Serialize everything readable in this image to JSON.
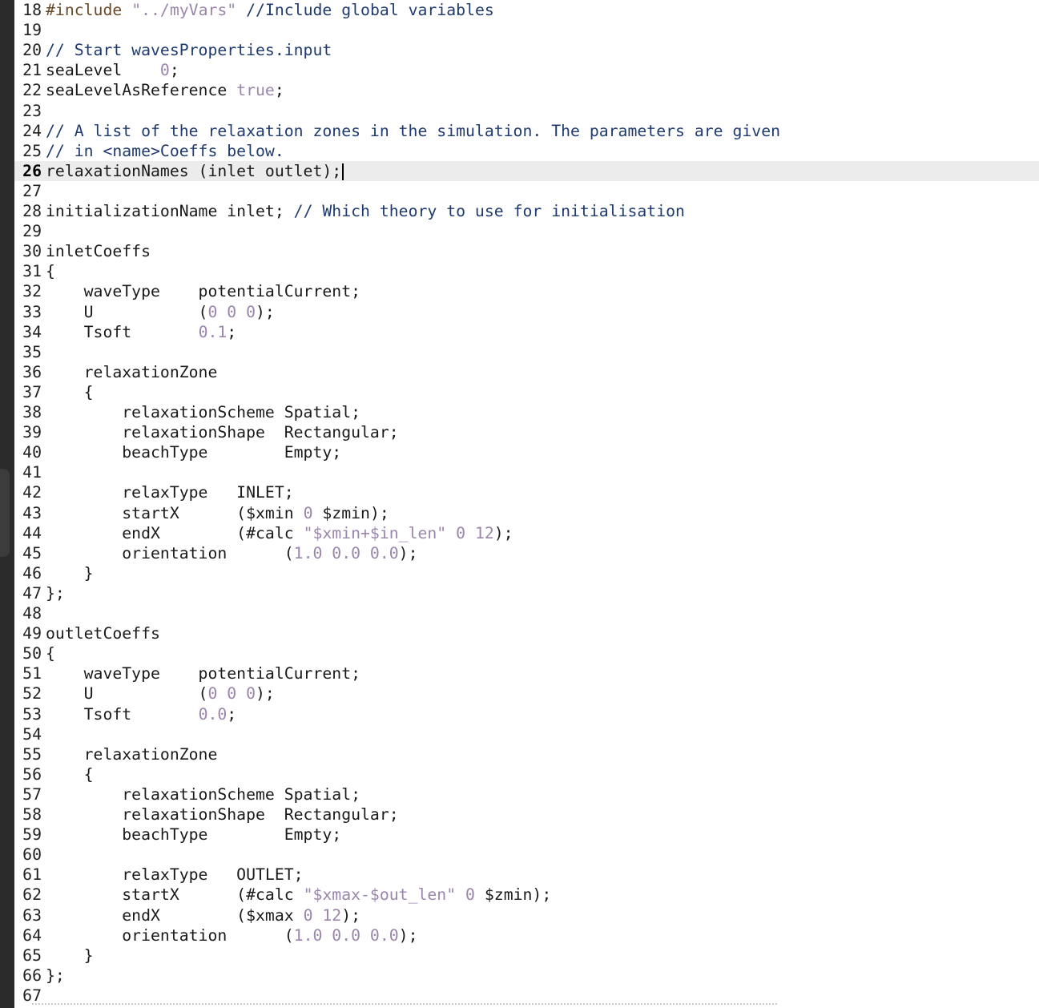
{
  "editor": {
    "current_line": "26",
    "lines": [
      {
        "n": "18",
        "tokens": [
          {
            "t": "preproc",
            "v": "#include"
          },
          {
            "t": "text",
            "v": " "
          },
          {
            "t": "string",
            "v": "\"../myVars\""
          },
          {
            "t": "text",
            "v": " "
          },
          {
            "t": "comment",
            "v": "//Include global variables"
          }
        ]
      },
      {
        "n": "19",
        "tokens": []
      },
      {
        "n": "20",
        "tokens": [
          {
            "t": "comment",
            "v": "// Start wavesProperties.input"
          }
        ]
      },
      {
        "n": "21",
        "tokens": [
          {
            "t": "text",
            "v": "seaLevel    "
          },
          {
            "t": "number",
            "v": "0"
          },
          {
            "t": "text",
            "v": ";"
          }
        ]
      },
      {
        "n": "22",
        "tokens": [
          {
            "t": "text",
            "v": "seaLevelAsReference "
          },
          {
            "t": "keyword",
            "v": "true"
          },
          {
            "t": "text",
            "v": ";"
          }
        ]
      },
      {
        "n": "23",
        "tokens": []
      },
      {
        "n": "24",
        "tokens": [
          {
            "t": "comment",
            "v": "// A list of the relaxation zones in the simulation. The parameters are given"
          }
        ]
      },
      {
        "n": "25",
        "tokens": [
          {
            "t": "comment",
            "v": "// in <name>Coeffs below."
          }
        ]
      },
      {
        "n": "26",
        "tokens": [
          {
            "t": "text",
            "v": "relaxationNames (inlet outlet);"
          }
        ]
      },
      {
        "n": "27",
        "tokens": []
      },
      {
        "n": "28",
        "tokens": [
          {
            "t": "text",
            "v": "initializationName inlet; "
          },
          {
            "t": "comment",
            "v": "// Which theory to use for initialisation"
          }
        ]
      },
      {
        "n": "29",
        "tokens": []
      },
      {
        "n": "30",
        "tokens": [
          {
            "t": "text",
            "v": "inletCoeffs"
          }
        ]
      },
      {
        "n": "31",
        "tokens": [
          {
            "t": "text",
            "v": "{"
          }
        ]
      },
      {
        "n": "32",
        "tokens": [
          {
            "t": "text",
            "v": "    waveType    potentialCurrent;"
          }
        ]
      },
      {
        "n": "33",
        "tokens": [
          {
            "t": "text",
            "v": "    U           ("
          },
          {
            "t": "number",
            "v": "0 0 0"
          },
          {
            "t": "text",
            "v": ");"
          }
        ]
      },
      {
        "n": "34",
        "tokens": [
          {
            "t": "text",
            "v": "    Tsoft       "
          },
          {
            "t": "number",
            "v": "0.1"
          },
          {
            "t": "text",
            "v": ";"
          }
        ]
      },
      {
        "n": "35",
        "tokens": []
      },
      {
        "n": "36",
        "tokens": [
          {
            "t": "text",
            "v": "    relaxationZone"
          }
        ]
      },
      {
        "n": "37",
        "tokens": [
          {
            "t": "text",
            "v": "    {"
          }
        ]
      },
      {
        "n": "38",
        "tokens": [
          {
            "t": "text",
            "v": "        relaxationScheme Spatial;"
          }
        ]
      },
      {
        "n": "39",
        "tokens": [
          {
            "t": "text",
            "v": "        relaxationShape  Rectangular;"
          }
        ]
      },
      {
        "n": "40",
        "tokens": [
          {
            "t": "text",
            "v": "        beachType        Empty;"
          }
        ]
      },
      {
        "n": "41",
        "tokens": []
      },
      {
        "n": "42",
        "tokens": [
          {
            "t": "text",
            "v": "        relaxType   INLET;"
          }
        ]
      },
      {
        "n": "43",
        "tokens": [
          {
            "t": "text",
            "v": "        startX      ($xmin "
          },
          {
            "t": "number",
            "v": "0"
          },
          {
            "t": "text",
            "v": " $zmin);"
          }
        ]
      },
      {
        "n": "44",
        "tokens": [
          {
            "t": "text",
            "v": "        endX        (#calc "
          },
          {
            "t": "string",
            "v": "\"$xmin+$in_len\""
          },
          {
            "t": "text",
            "v": " "
          },
          {
            "t": "number",
            "v": "0 12"
          },
          {
            "t": "text",
            "v": ");"
          }
        ]
      },
      {
        "n": "45",
        "tokens": [
          {
            "t": "text",
            "v": "        orientation      ("
          },
          {
            "t": "number",
            "v": "1.0 0.0 0.0"
          },
          {
            "t": "text",
            "v": ");"
          }
        ]
      },
      {
        "n": "46",
        "tokens": [
          {
            "t": "text",
            "v": "    }"
          }
        ]
      },
      {
        "n": "47",
        "tokens": [
          {
            "t": "text",
            "v": "};"
          }
        ]
      },
      {
        "n": "48",
        "tokens": []
      },
      {
        "n": "49",
        "tokens": [
          {
            "t": "text",
            "v": "outletCoeffs"
          }
        ]
      },
      {
        "n": "50",
        "tokens": [
          {
            "t": "text",
            "v": "{"
          }
        ]
      },
      {
        "n": "51",
        "tokens": [
          {
            "t": "text",
            "v": "    waveType    potentialCurrent;"
          }
        ]
      },
      {
        "n": "52",
        "tokens": [
          {
            "t": "text",
            "v": "    U           ("
          },
          {
            "t": "number",
            "v": "0 0 0"
          },
          {
            "t": "text",
            "v": ");"
          }
        ]
      },
      {
        "n": "53",
        "tokens": [
          {
            "t": "text",
            "v": "    Tsoft       "
          },
          {
            "t": "number",
            "v": "0.0"
          },
          {
            "t": "text",
            "v": ";"
          }
        ]
      },
      {
        "n": "54",
        "tokens": []
      },
      {
        "n": "55",
        "tokens": [
          {
            "t": "text",
            "v": "    relaxationZone"
          }
        ]
      },
      {
        "n": "56",
        "tokens": [
          {
            "t": "text",
            "v": "    {"
          }
        ]
      },
      {
        "n": "57",
        "tokens": [
          {
            "t": "text",
            "v": "        relaxationScheme Spatial;"
          }
        ]
      },
      {
        "n": "58",
        "tokens": [
          {
            "t": "text",
            "v": "        relaxationShape  Rectangular;"
          }
        ]
      },
      {
        "n": "59",
        "tokens": [
          {
            "t": "text",
            "v": "        beachType        Empty;"
          }
        ]
      },
      {
        "n": "60",
        "tokens": []
      },
      {
        "n": "61",
        "tokens": [
          {
            "t": "text",
            "v": "        relaxType   OUTLET;"
          }
        ]
      },
      {
        "n": "62",
        "tokens": [
          {
            "t": "text",
            "v": "        startX      (#calc "
          },
          {
            "t": "string",
            "v": "\"$xmax-$out_len\""
          },
          {
            "t": "text",
            "v": " "
          },
          {
            "t": "number",
            "v": "0"
          },
          {
            "t": "text",
            "v": " $zmin);"
          }
        ]
      },
      {
        "n": "63",
        "tokens": [
          {
            "t": "text",
            "v": "        endX        ($xmax "
          },
          {
            "t": "number",
            "v": "0 12"
          },
          {
            "t": "text",
            "v": ");"
          }
        ]
      },
      {
        "n": "64",
        "tokens": [
          {
            "t": "text",
            "v": "        orientation      ("
          },
          {
            "t": "number",
            "v": "1.0 0.0 0.0"
          },
          {
            "t": "text",
            "v": ");"
          }
        ]
      },
      {
        "n": "65",
        "tokens": [
          {
            "t": "text",
            "v": "    }"
          }
        ]
      },
      {
        "n": "66",
        "tokens": [
          {
            "t": "text",
            "v": "};"
          }
        ]
      },
      {
        "n": "67",
        "tokens": []
      }
    ]
  }
}
